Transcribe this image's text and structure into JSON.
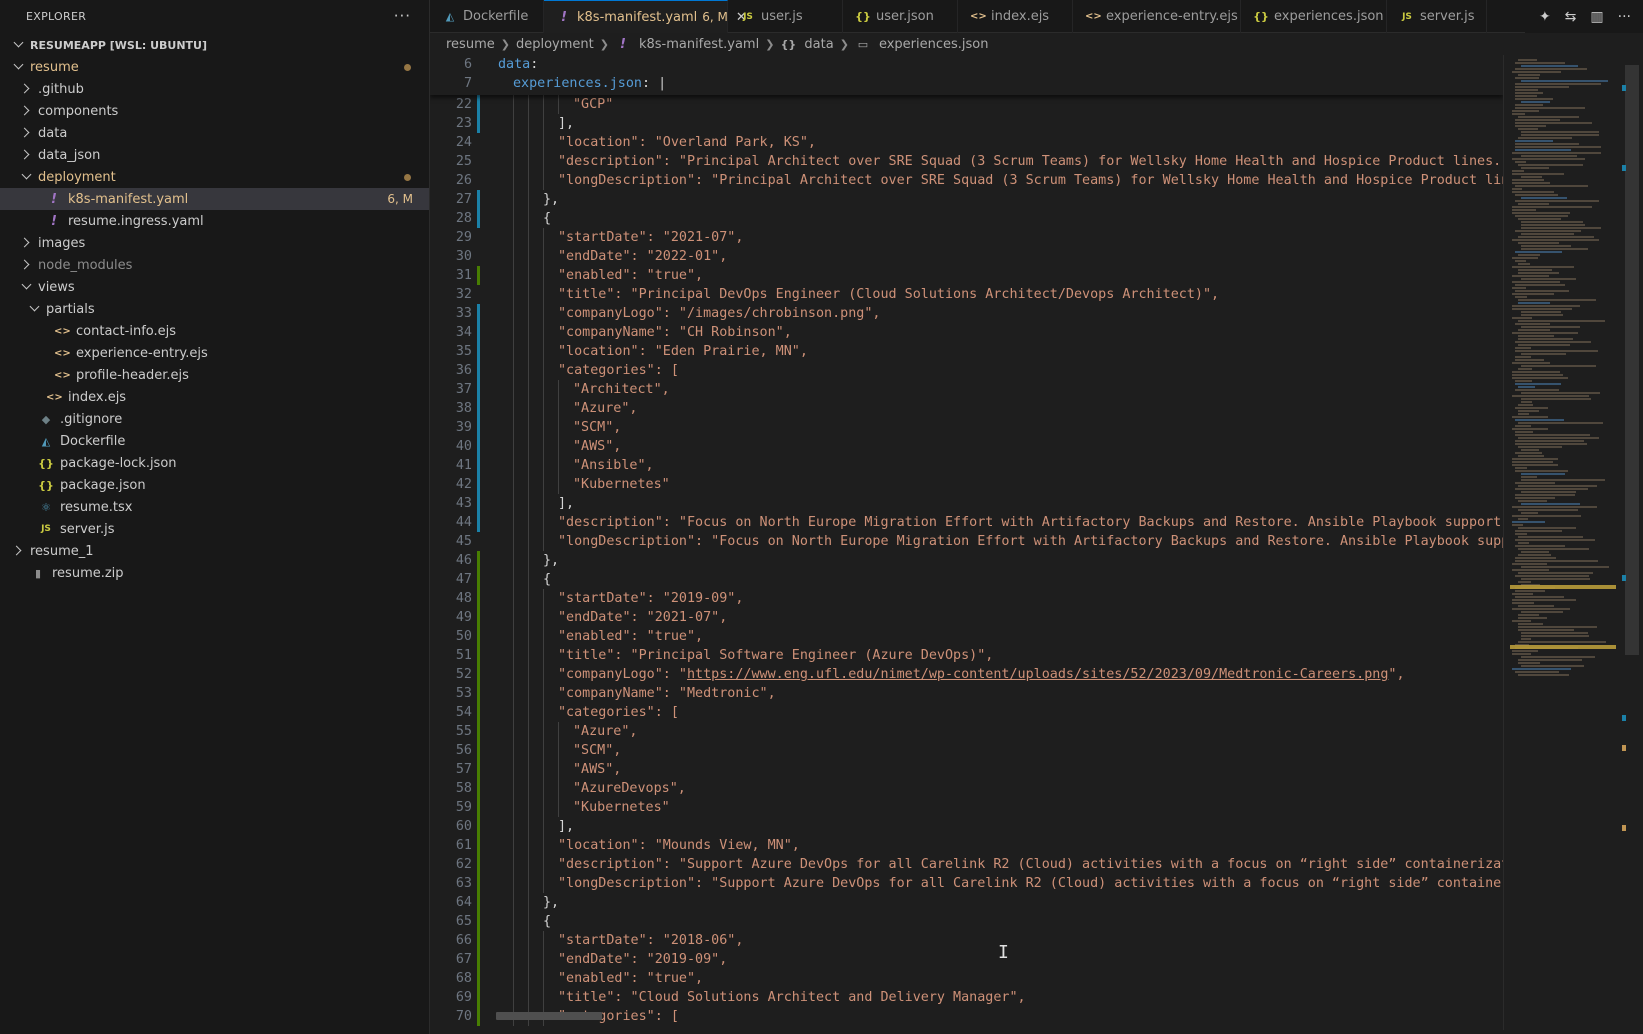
{
  "explorer": {
    "title": "EXPLORER",
    "more": "···",
    "root": "RESUMEAPP [WSL: UBUNTU]",
    "items": [
      {
        "label": "resume",
        "indent": 1,
        "type": "folder-open",
        "color": "yellow",
        "dot": true
      },
      {
        "label": ".github",
        "indent": 2,
        "type": "folder-closed"
      },
      {
        "label": "components",
        "indent": 2,
        "type": "folder-closed"
      },
      {
        "label": "data",
        "indent": 2,
        "type": "folder-closed"
      },
      {
        "label": "data_json",
        "indent": 2,
        "type": "folder-closed"
      },
      {
        "label": "deployment",
        "indent": 2,
        "type": "folder-open",
        "color": "yellow",
        "dot": true
      },
      {
        "label": "k8s-manifest.yaml",
        "indent": 3,
        "type": "file",
        "icon": "!",
        "iconClass": "excl",
        "color": "yellow",
        "badge": "6, M",
        "selected": true
      },
      {
        "label": "resume.ingress.yaml",
        "indent": 3,
        "type": "file",
        "icon": "!",
        "iconClass": "excl"
      },
      {
        "label": "images",
        "indent": 2,
        "type": "folder-closed"
      },
      {
        "label": "node_modules",
        "indent": 2,
        "type": "folder-closed",
        "color": "dim"
      },
      {
        "label": "views",
        "indent": 2,
        "type": "folder-open"
      },
      {
        "label": "partials",
        "indent": 3,
        "type": "folder-open"
      },
      {
        "label": "contact-info.ejs",
        "indent": 4,
        "type": "file",
        "icon": "<>",
        "iconClass": "ejs"
      },
      {
        "label": "experience-entry.ejs",
        "indent": 4,
        "type": "file",
        "icon": "<>",
        "iconClass": "ejs"
      },
      {
        "label": "profile-header.ejs",
        "indent": 4,
        "type": "file",
        "icon": "<>",
        "iconClass": "ejs"
      },
      {
        "label": "index.ejs",
        "indent": 3,
        "type": "file",
        "icon": "<>",
        "iconClass": "ejs"
      },
      {
        "label": ".gitignore",
        "indent": 2,
        "type": "file",
        "icon": "◆",
        "iconClass": "git"
      },
      {
        "label": "Dockerfile",
        "indent": 2,
        "type": "file",
        "icon": "◭",
        "iconClass": "docker"
      },
      {
        "label": "package-lock.json",
        "indent": 2,
        "type": "file",
        "icon": "{}",
        "iconClass": "json"
      },
      {
        "label": "package.json",
        "indent": 2,
        "type": "file",
        "icon": "{}",
        "iconClass": "json"
      },
      {
        "label": "resume.tsx",
        "indent": 2,
        "type": "file",
        "icon": "⚛",
        "iconClass": "tsx"
      },
      {
        "label": "server.js",
        "indent": 2,
        "type": "file",
        "icon": "JS",
        "iconClass": "js"
      },
      {
        "label": "resume_1",
        "indent": 1,
        "type": "folder-closed"
      },
      {
        "label": "resume.zip",
        "indent": 1,
        "type": "file",
        "icon": "▮",
        "iconClass": "zip"
      }
    ]
  },
  "tabs": [
    {
      "label": "Dockerfile",
      "icon": "◭",
      "iconClass": "docker",
      "width": 114
    },
    {
      "label": "k8s-manifest.yaml",
      "icon": "!",
      "iconClass": "excl",
      "badge": "6, M",
      "active": true,
      "close": "✕",
      "width": 184
    },
    {
      "label": "user.js",
      "icon": "JS",
      "iconClass": "js",
      "width": 115
    },
    {
      "label": "user.json",
      "icon": "{}",
      "iconClass": "json",
      "width": 115
    },
    {
      "label": "index.ejs",
      "icon": "<>",
      "iconClass": "ejs",
      "width": 115
    },
    {
      "label": "experience-entry.ejs",
      "icon": "<>",
      "iconClass": "ejs",
      "width": 168
    },
    {
      "label": "experiences.json",
      "icon": "{}",
      "iconClass": "json",
      "width": 146
    },
    {
      "label": "server.js",
      "icon": "JS",
      "iconClass": "js",
      "width": 100
    }
  ],
  "tab_actions": [
    "✦",
    "⇆",
    "▥",
    "···"
  ],
  "breadcrumb": [
    {
      "label": "resume",
      "icon": ""
    },
    {
      "label": "deployment",
      "icon": ""
    },
    {
      "label": "k8s-manifest.yaml",
      "icon": "!"
    },
    {
      "label": "data",
      "icon": "{}"
    },
    {
      "label": "experiences.json",
      "icon": "▭"
    }
  ],
  "sticky": [
    {
      "n": "6",
      "indent": 0,
      "segs": [
        {
          "t": "data",
          "c": "k"
        },
        {
          "t": ":",
          "c": "p"
        }
      ]
    },
    {
      "n": "7",
      "indent": 1,
      "segs": [
        {
          "t": "experiences.json",
          "c": "k"
        },
        {
          "t": ": ",
          "c": "p"
        },
        {
          "t": "|",
          "c": "cursor"
        }
      ]
    }
  ],
  "lines": [
    {
      "n": "22",
      "indent": 5,
      "segs": [
        {
          "t": "\"GCP\""
        }
      ]
    },
    {
      "n": "23",
      "indent": 4,
      "segs": [
        {
          "t": "],",
          "c": "p"
        }
      ]
    },
    {
      "n": "24",
      "indent": 4,
      "segs": [
        {
          "t": "\"location\": \"Overland Park, KS\","
        }
      ]
    },
    {
      "n": "25",
      "indent": 4,
      "segs": [
        {
          "t": "\"description\": \"Principal Architect over SRE Squad (3 Scrum Teams) for Wellsky Home Health and Hospice Product lines. Focus"
        }
      ]
    },
    {
      "n": "26",
      "indent": 4,
      "segs": [
        {
          "t": "\"longDescription\": \"Principal Architect over SRE Squad (3 Scrum Teams) for Wellsky Home Health and Hospice Product lines. F"
        }
      ]
    },
    {
      "n": "27",
      "indent": 3,
      "segs": [
        {
          "t": "},",
          "c": "p"
        }
      ]
    },
    {
      "n": "28",
      "indent": 3,
      "segs": [
        {
          "t": "{",
          "c": "p"
        }
      ]
    },
    {
      "n": "29",
      "indent": 4,
      "segs": [
        {
          "t": "\"startDate\": \"2021-07\","
        }
      ]
    },
    {
      "n": "30",
      "indent": 4,
      "segs": [
        {
          "t": "\"endDate\": \"2022-01\","
        }
      ]
    },
    {
      "n": "31",
      "indent": 4,
      "segs": [
        {
          "t": "\"enabled\": \"true\","
        }
      ]
    },
    {
      "n": "32",
      "indent": 4,
      "segs": [
        {
          "t": "\"title\": \"Principal DevOps Engineer (Cloud Solutions Architect/Devops Architect)\","
        }
      ]
    },
    {
      "n": "33",
      "indent": 4,
      "segs": [
        {
          "t": "\"companyLogo\": \"/images/chrobinson.png\","
        }
      ]
    },
    {
      "n": "34",
      "indent": 4,
      "segs": [
        {
          "t": "\"companyName\": \"CH Robinson\","
        }
      ]
    },
    {
      "n": "35",
      "indent": 4,
      "segs": [
        {
          "t": "\"location\": \"Eden Prairie, MN\","
        }
      ]
    },
    {
      "n": "36",
      "indent": 4,
      "segs": [
        {
          "t": "\"categories\": ["
        }
      ]
    },
    {
      "n": "37",
      "indent": 5,
      "segs": [
        {
          "t": "\"Architect\","
        }
      ]
    },
    {
      "n": "38",
      "indent": 5,
      "segs": [
        {
          "t": "\"Azure\","
        }
      ]
    },
    {
      "n": "39",
      "indent": 5,
      "segs": [
        {
          "t": "\"SCM\","
        }
      ]
    },
    {
      "n": "40",
      "indent": 5,
      "segs": [
        {
          "t": "\"AWS\","
        }
      ]
    },
    {
      "n": "41",
      "indent": 5,
      "segs": [
        {
          "t": "\"Ansible\","
        }
      ]
    },
    {
      "n": "42",
      "indent": 5,
      "segs": [
        {
          "t": "\"Kubernetes\""
        }
      ]
    },
    {
      "n": "43",
      "indent": 4,
      "segs": [
        {
          "t": "],",
          "c": "p"
        }
      ]
    },
    {
      "n": "44",
      "indent": 4,
      "segs": [
        {
          "t": "\"description\": \"Focus on North Europe Migration Effort with Artifactory Backups and Restore. Ansible Playbook support.\","
        }
      ]
    },
    {
      "n": "45",
      "indent": 4,
      "segs": [
        {
          "t": "\"longDescription\": \"Focus on North Europe Migration Effort with Artifactory Backups and Restore. Ansible Playbook support."
        }
      ]
    },
    {
      "n": "46",
      "indent": 3,
      "segs": [
        {
          "t": "},",
          "c": "p"
        }
      ]
    },
    {
      "n": "47",
      "indent": 3,
      "segs": [
        {
          "t": "{",
          "c": "p"
        }
      ]
    },
    {
      "n": "48",
      "indent": 4,
      "segs": [
        {
          "t": "\"startDate\": \"2019-09\","
        }
      ]
    },
    {
      "n": "49",
      "indent": 4,
      "segs": [
        {
          "t": "\"endDate\": \"2021-07\","
        }
      ]
    },
    {
      "n": "50",
      "indent": 4,
      "segs": [
        {
          "t": "\"enabled\": \"true\","
        }
      ]
    },
    {
      "n": "51",
      "indent": 4,
      "segs": [
        {
          "t": "\"title\": \"Principal Software Engineer (Azure DevOps)\","
        }
      ]
    },
    {
      "n": "52",
      "indent": 4,
      "segs": [
        {
          "t": "\"companyLogo\": \""
        },
        {
          "t": "https://www.eng.ufl.edu/nimet/wp-content/uploads/sites/52/2023/09/Medtronic-Careers.png",
          "c": "u"
        },
        {
          "t": "\","
        }
      ]
    },
    {
      "n": "53",
      "indent": 4,
      "segs": [
        {
          "t": "\"companyName\": \"Medtronic\","
        }
      ]
    },
    {
      "n": "54",
      "indent": 4,
      "segs": [
        {
          "t": "\"categories\": ["
        }
      ]
    },
    {
      "n": "55",
      "indent": 5,
      "segs": [
        {
          "t": "\"Azure\","
        }
      ]
    },
    {
      "n": "56",
      "indent": 5,
      "segs": [
        {
          "t": "\"SCM\","
        }
      ]
    },
    {
      "n": "57",
      "indent": 5,
      "segs": [
        {
          "t": "\"AWS\","
        }
      ]
    },
    {
      "n": "58",
      "indent": 5,
      "segs": [
        {
          "t": "\"AzureDevops\","
        }
      ]
    },
    {
      "n": "59",
      "indent": 5,
      "segs": [
        {
          "t": "\"Kubernetes\""
        }
      ]
    },
    {
      "n": "60",
      "indent": 4,
      "segs": [
        {
          "t": "],",
          "c": "p"
        }
      ]
    },
    {
      "n": "61",
      "indent": 4,
      "segs": [
        {
          "t": "\"location\": \"Mounds View, MN\","
        }
      ]
    },
    {
      "n": "62",
      "indent": 4,
      "segs": [
        {
          "t": "\"description\": \"Support Azure DevOps for all Carelink R2 (Cloud) activities with a focus on “right side” containerization,"
        }
      ]
    },
    {
      "n": "63",
      "indent": 4,
      "segs": [
        {
          "t": "\"longDescription\": \"Support Azure DevOps for all Carelink R2 (Cloud) activities with a focus on “right side” containerizati"
        }
      ]
    },
    {
      "n": "64",
      "indent": 3,
      "segs": [
        {
          "t": "},",
          "c": "p"
        }
      ]
    },
    {
      "n": "65",
      "indent": 3,
      "segs": [
        {
          "t": "{",
          "c": "p"
        }
      ]
    },
    {
      "n": "66",
      "indent": 4,
      "segs": [
        {
          "t": "\"startDate\": \"2018-06\","
        }
      ]
    },
    {
      "n": "67",
      "indent": 4,
      "segs": [
        {
          "t": "\"endDate\": \"2019-09\","
        }
      ]
    },
    {
      "n": "68",
      "indent": 4,
      "segs": [
        {
          "t": "\"enabled\": \"true\","
        }
      ]
    },
    {
      "n": "69",
      "indent": 4,
      "segs": [
        {
          "t": "\"title\": \"Cloud Solutions Architect and Delivery Manager\","
        }
      ]
    },
    {
      "n": "70",
      "indent": 4,
      "segs": [
        {
          "t": "\"categories\": ["
        }
      ]
    }
  ],
  "gutter": {
    "blue": [
      [
        22,
        23
      ],
      [
        27,
        28
      ],
      [
        33,
        44
      ]
    ],
    "green": [
      [
        31,
        31
      ],
      [
        46,
        70
      ]
    ]
  },
  "colors": {
    "accent": "#0078d4",
    "modified": "#e2c08d",
    "string": "#ce9178",
    "key": "#569cd6"
  }
}
